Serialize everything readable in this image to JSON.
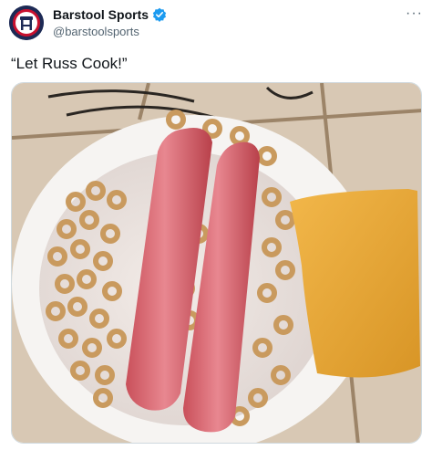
{
  "tweet": {
    "display_name": "Barstool Sports",
    "handle": "@barstoolsports",
    "text": "“Let Russ Cook!”",
    "more_label": "···"
  },
  "icons": {
    "avatar": "barstool-logo",
    "verified": "verified-badge-icon",
    "more": "more-options-icon"
  },
  "colors": {
    "verified": "#1d9bf0",
    "avatar_bg": "#1d2a55",
    "avatar_accent": "#c8102e"
  }
}
